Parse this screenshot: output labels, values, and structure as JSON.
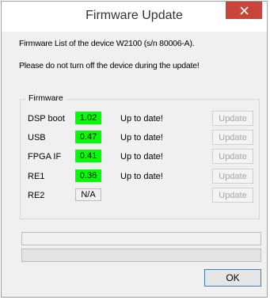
{
  "window": {
    "title": "Firmware Update",
    "close_label": "✕"
  },
  "info": {
    "device_line": "Firmware List of the device W2100 (s/n 80006-A).",
    "warning_line": "Please do not turn off the device during the update!"
  },
  "group": {
    "title": "Firmware"
  },
  "firmware": [
    {
      "name": "DSP boot",
      "version": "1.02",
      "status": "Up to date!",
      "button": "Update",
      "version_color": "#00ff00"
    },
    {
      "name": "USB",
      "version": "0.47",
      "status": "Up to date!",
      "button": "Update",
      "version_color": "#00ff00"
    },
    {
      "name": "FPGA IF",
      "version": "0.41",
      "status": "Up to date!",
      "button": "Update",
      "version_color": "#00ff00"
    },
    {
      "name": "RE1",
      "version": "0.36",
      "status": "Up to date!",
      "button": "Update",
      "version_color": "#00ff00"
    },
    {
      "name": "RE2",
      "version": "N/A",
      "status": "",
      "button": "Update",
      "version_color": "#f0f0f0"
    }
  ],
  "progress": {
    "bar1": 0,
    "bar2": 0
  },
  "footer": {
    "ok_label": "OK"
  },
  "colors": {
    "close_button": "#c7453a",
    "up_to_date": "#00ff00",
    "ok_border": "#3c7fb1"
  }
}
